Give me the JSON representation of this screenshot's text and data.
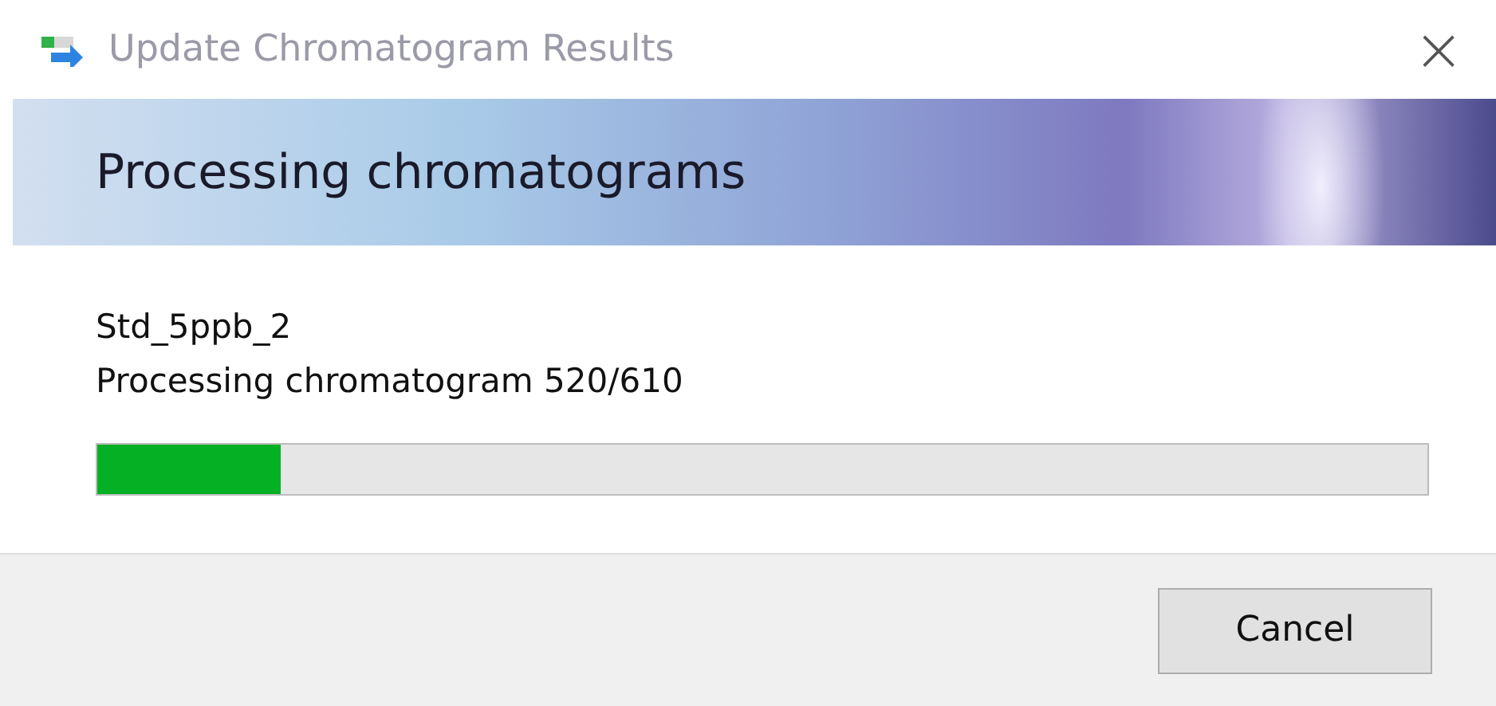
{
  "window": {
    "title": "Update Chromatogram Results",
    "close": "×"
  },
  "banner": {
    "heading": "Processing chromatograms"
  },
  "status": {
    "item": "Std_5ppb_2",
    "message": "Processing chromatogram 520/610"
  },
  "progress": {
    "level": 0.138
  },
  "buttons": [
    {
      "label": "Cancel"
    }
  ]
}
